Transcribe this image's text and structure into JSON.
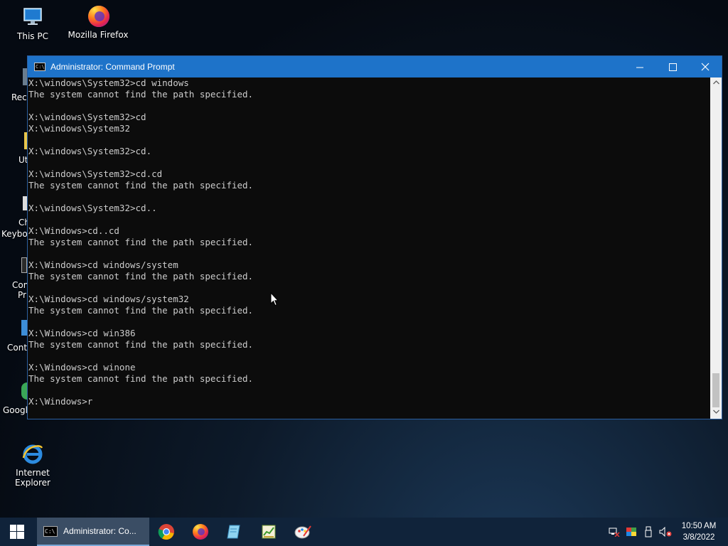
{
  "desktop": {
    "icons": [
      {
        "label": "This PC",
        "icon": "this-pc-icon"
      },
      {
        "label": "Mozilla Firefox",
        "icon": "firefox-icon"
      },
      {
        "label": "Internet Explorer",
        "icon": "internet-explorer-icon"
      }
    ],
    "partial_labels": [
      "Recy",
      "Ut",
      "Ch",
      "Keyboa",
      "Com",
      "Pr",
      "Contr",
      "Googl"
    ]
  },
  "window": {
    "title": "Administrator: Command Prompt",
    "icon_text": "C:\\",
    "controls": {
      "minimize": "—",
      "maximize": "☐",
      "close": "✕"
    },
    "lines": [
      "X:\\windows\\System32>cd windows",
      "The system cannot find the path specified.",
      "",
      "X:\\windows\\System32>cd",
      "X:\\windows\\System32",
      "",
      "X:\\windows\\System32>cd.",
      "",
      "X:\\windows\\System32>cd.cd",
      "The system cannot find the path specified.",
      "",
      "X:\\windows\\System32>cd..",
      "",
      "X:\\Windows>cd..cd",
      "The system cannot find the path specified.",
      "",
      "X:\\Windows>cd windows/system",
      "The system cannot find the path specified.",
      "",
      "X:\\Windows>cd windows/system32",
      "The system cannot find the path specified.",
      "",
      "X:\\Windows>cd win386",
      "The system cannot find the path specified.",
      "",
      "X:\\Windows>cd winone",
      "The system cannot find the path specified.",
      "",
      "X:\\Windows>r"
    ]
  },
  "taskbar": {
    "active_task_label": "Administrator: Co...",
    "active_task_icon_text": "C:\\",
    "pinned": [
      "chrome-icon",
      "firefox-icon",
      "notepad-icon",
      "spreadsheet-icon",
      "paint-icon"
    ],
    "tray": [
      "network-icon",
      "color-icon",
      "usb-icon",
      "volume-muted-icon"
    ],
    "clock_time": "10:50 AM",
    "clock_date": "3/8/2022"
  },
  "colors": {
    "titlebar": "#1e73c9",
    "console_bg": "#0c0c0c",
    "console_text": "#cccccc",
    "taskbar": "#10233a"
  }
}
